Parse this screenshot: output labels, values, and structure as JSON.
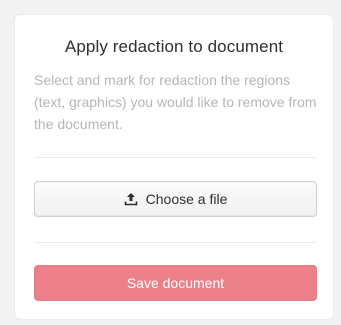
{
  "panel": {
    "title": "Apply redaction to document",
    "description": "Select and mark for redaction the regions (text, graphics) you would like to remove from the document."
  },
  "actions": {
    "choose_file_label": "Choose a file",
    "choose_file_icon": "upload-icon",
    "save_label": "Save document"
  },
  "colors": {
    "accent": "#ec8088",
    "text_primary": "#2f2f33",
    "text_muted": "#b6b6bb"
  }
}
